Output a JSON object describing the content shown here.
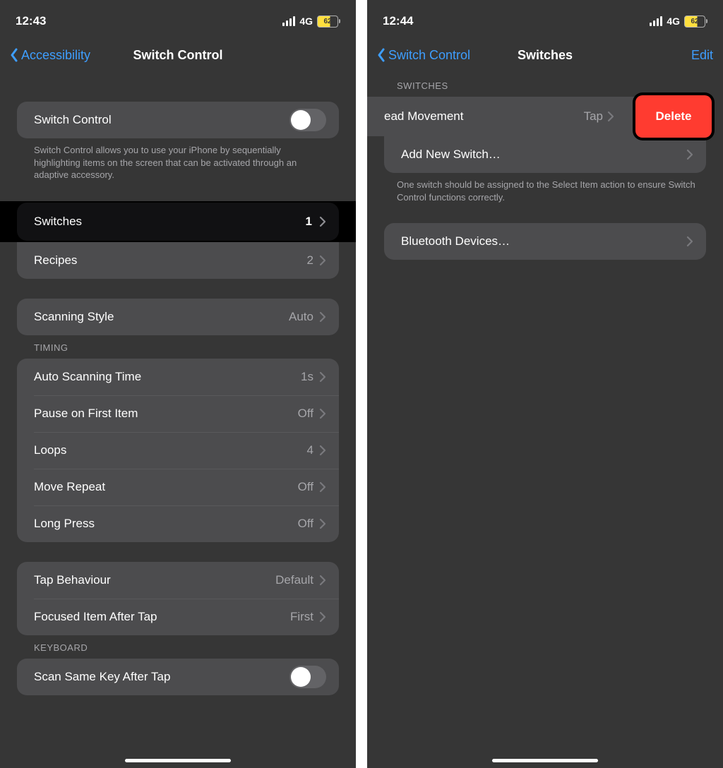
{
  "left": {
    "status": {
      "time": "12:43",
      "network": "4G",
      "battery": "62"
    },
    "nav": {
      "back": "Accessibility",
      "title": "Switch Control"
    },
    "sc_toggle": {
      "label": "Switch Control"
    },
    "sc_footer": "Switch Control allows you to use your iPhone by sequentially highlighting items on the screen that can be activated through an adaptive accessory.",
    "switches": {
      "label": "Switches",
      "value": "1"
    },
    "recipes": {
      "label": "Recipes",
      "value": "2"
    },
    "scanning": {
      "label": "Scanning Style",
      "value": "Auto"
    },
    "timing_header": "TIMING",
    "timing": {
      "auto": {
        "label": "Auto Scanning Time",
        "value": "1s"
      },
      "pause": {
        "label": "Pause on First Item",
        "value": "Off"
      },
      "loops": {
        "label": "Loops",
        "value": "4"
      },
      "move": {
        "label": "Move Repeat",
        "value": "Off"
      },
      "long": {
        "label": "Long Press",
        "value": "Off"
      }
    },
    "tap": {
      "label": "Tap Behaviour",
      "value": "Default"
    },
    "focus": {
      "label": "Focused Item After Tap",
      "value": "First"
    },
    "keyboard_header": "KEYBOARD",
    "scan_same": {
      "label": "Scan Same Key After Tap"
    }
  },
  "right": {
    "status": {
      "time": "12:44",
      "network": "4G",
      "battery": "62"
    },
    "nav": {
      "back": "Switch Control",
      "title": "Switches",
      "right": "Edit"
    },
    "switches_header": "SWITCHES",
    "head_row": {
      "label": "ead Movement",
      "value": "Tap",
      "delete": "Delete"
    },
    "add": {
      "label": "Add New Switch…"
    },
    "footer": "One switch should be assigned to the Select Item action to ensure Switch Control functions correctly.",
    "bt": {
      "label": "Bluetooth Devices…"
    }
  }
}
